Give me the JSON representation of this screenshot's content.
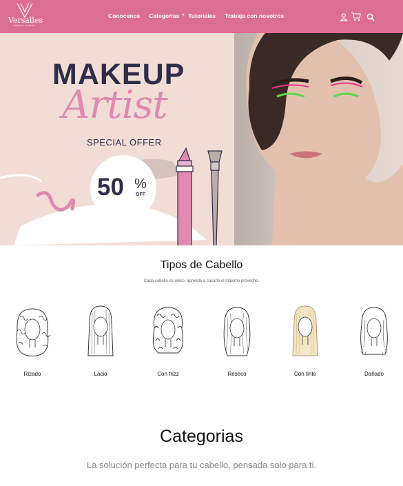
{
  "nav": {
    "brand": "Versalles",
    "brand_sub": "BEAUTY SUPPLY",
    "items": [
      "Conocenos",
      "Categorias",
      "Tutoriales",
      "Trabaja con nosotros"
    ],
    "caret": "▾",
    "icons": [
      "user-icon",
      "cart-icon",
      "search-icon"
    ]
  },
  "hero": {
    "title": "MAKEUP",
    "script": "Artist",
    "offer": "SPECIAL OFFER",
    "discount_number": "50",
    "discount_percent": "%",
    "discount_off": "OFF"
  },
  "hair_types": {
    "title": "Tipos de Cabello",
    "subtitle": "Cada cabello es único, aprende a sacarle el máximo provecho.",
    "items": [
      {
        "label": "Rizado",
        "icon": "curly-hair-icon"
      },
      {
        "label": "Lacio",
        "icon": "straight-hair-icon"
      },
      {
        "label": "Con frizz",
        "icon": "frizzy-hair-icon"
      },
      {
        "label": "Reseco",
        "icon": "dry-hair-icon"
      },
      {
        "label": "Con tinte",
        "icon": "dyed-hair-icon"
      },
      {
        "label": "Dañado",
        "icon": "damaged-hair-icon"
      }
    ]
  },
  "categories": {
    "title": "Categorias",
    "subtitle": "La solución perfecta para tu cabello, pensada solo para ti."
  },
  "colors": {
    "nav_bg": "#dc6e93",
    "hero_bg": "#f2dcd6",
    "navy": "#2f2e48",
    "pink": "#e08ab2"
  }
}
